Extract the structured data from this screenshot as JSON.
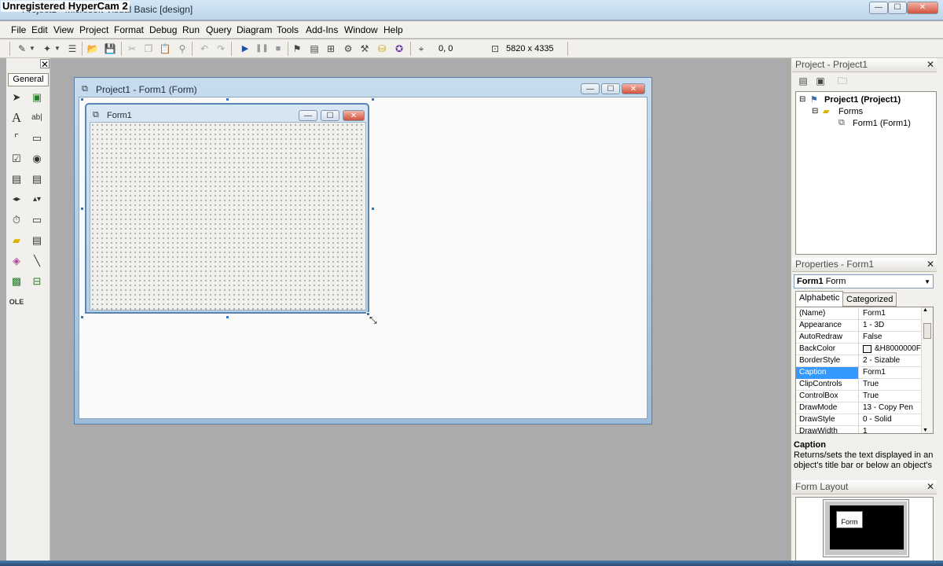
{
  "app": {
    "title": "Project1 - Microsoft Visual Basic [design]",
    "overlay_watermark": "Unregistered HyperCam 2",
    "min": "—",
    "max": "☐",
    "close": "✕"
  },
  "menu": [
    "File",
    "Edit",
    "View",
    "Project",
    "Format",
    "Debug",
    "Run",
    "Query",
    "Diagram",
    "Tools",
    "Add-Ins",
    "Window",
    "Help"
  ],
  "toolbar": {
    "position": "0, 0",
    "size": "5820 x 4335"
  },
  "toolbox": {
    "tab_label": "General",
    "close": "✕"
  },
  "designer": {
    "title": "Project1 - Form1 (Form)"
  },
  "form": {
    "caption": "Form1"
  },
  "project": {
    "header": "Project - Project1",
    "close": "✕",
    "root": "Project1 (Project1)",
    "folder": "Forms",
    "item": "Form1 (Form1)"
  },
  "properties": {
    "header": "Properties - Form1",
    "close": "✕",
    "object_name": "Form1",
    "object_type": "Form",
    "tabs": [
      "Alphabetic",
      "Categorized"
    ],
    "rows": [
      {
        "name": "(Name)",
        "value": "Form1"
      },
      {
        "name": "Appearance",
        "value": "1 - 3D"
      },
      {
        "name": "AutoRedraw",
        "value": "False"
      },
      {
        "name": "BackColor",
        "value": "&H8000000F"
      },
      {
        "name": "BorderStyle",
        "value": "2 - Sizable"
      },
      {
        "name": "Caption",
        "value": "Form1"
      },
      {
        "name": "ClipControls",
        "value": "True"
      },
      {
        "name": "ControlBox",
        "value": "True"
      },
      {
        "name": "DrawMode",
        "value": "13 - Copy Pen"
      },
      {
        "name": "DrawStyle",
        "value": "0 - Solid"
      },
      {
        "name": "DrawWidth",
        "value": "1"
      }
    ],
    "description_title": "Caption",
    "description_text": "Returns/sets the text displayed in an object's title bar or below an object's"
  },
  "form_layout": {
    "header": "Form Layout",
    "close": "✕",
    "form_label": "Form"
  },
  "colors": {
    "selection": "#3399ff",
    "titlebar": "#bdd6ea",
    "toolbar_bg": "#f1f0ec"
  }
}
